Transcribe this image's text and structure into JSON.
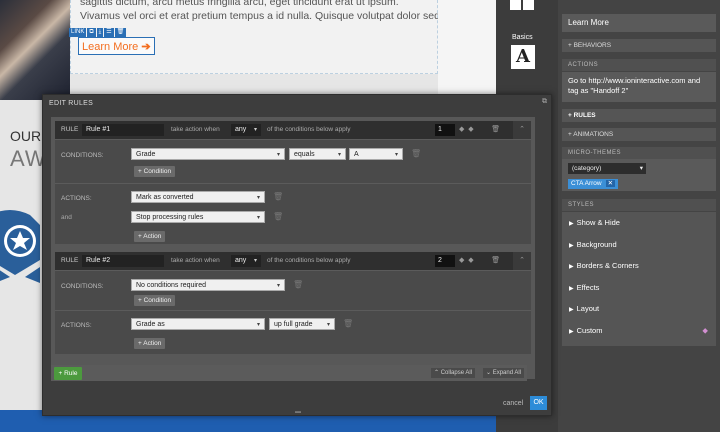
{
  "canvas": {
    "body_line1": "sagittis dictum, arcu metus fringilla arcu, eget tincidunt erat ut ipsum.",
    "body_line2": "Vivamus vel orci et erat pretium tempus a id nulla. Quisque volutpat dolor sed",
    "link_toolbar": [
      "LINK",
      "⧉",
      "⤓",
      "☰",
      "🗑"
    ],
    "learn_more": "Learn More",
    "arrow": "➔",
    "our": "OUR",
    "aw": "AW"
  },
  "tool_strip": {
    "basics_label": "Basics",
    "basics_icon": "A"
  },
  "right_panel": {
    "learn_more": "Learn More",
    "behaviors": "+ BEHAVIORS",
    "actions_header": "ACTIONS",
    "actions_text": "Go to http://www.ioninteractive.com and tag as \"Handoff 2\"",
    "rules": "+ RULES",
    "animations": "+ ANIMATIONS",
    "micro_header": "MICRO-THEMES",
    "category": "(category)",
    "cta_tag": "CTA Arrow",
    "cta_tag_remove": "✕",
    "styles_header": "STYLES",
    "styles": [
      "Show & Hide",
      "Background",
      "Borders & Corners",
      "Effects",
      "Layout",
      "Custom"
    ]
  },
  "modal": {
    "title": "EDIT RULES",
    "pop_icon": "⧉",
    "rule_label": "RULE",
    "take_action": "take action when",
    "apply_text": "of the conditions below apply",
    "conditions_label": "CONDITIONS:",
    "actions_label": "ACTIONS:",
    "and_label": "and",
    "add_condition": "+ Condition",
    "add_action": "+ Action",
    "rule1": {
      "name": "Rule #1",
      "match": "any",
      "priority": "1",
      "condition": {
        "field": "Grade",
        "operator": "equals",
        "value": "A"
      },
      "actions": [
        "Mark as converted",
        "Stop processing rules"
      ]
    },
    "rule2": {
      "name": "Rule #2",
      "match": "any",
      "priority": "2",
      "condition": "No conditions required",
      "action": "Grade as",
      "action_value": "up full grade"
    },
    "add_rule": "+ Rule",
    "collapse_all": "⌃ Collapse All",
    "expand_all": "⌄ Expand All",
    "cancel": "cancel",
    "ok": "OK"
  },
  "colors": {
    "accent": "#2d8cd8",
    "link_orange": "#f36f21",
    "add_rule_green": "#4c9a3e",
    "tag_blue": "#3b8fd6"
  }
}
